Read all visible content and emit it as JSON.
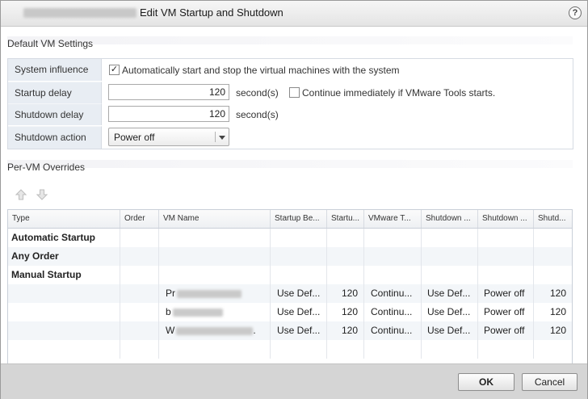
{
  "window": {
    "title": "Edit VM Startup and Shutdown",
    "help_label": "?"
  },
  "default_settings": {
    "title": "Default VM Settings",
    "system_influence": {
      "label": "System influence",
      "checked": true,
      "text": "Automatically start and stop the virtual machines with the system"
    },
    "startup_delay": {
      "label": "Startup delay",
      "value": "120",
      "unit": "second(s)",
      "continue_checked": false,
      "continue_text": "Continue immediately if VMware Tools starts."
    },
    "shutdown_delay": {
      "label": "Shutdown delay",
      "value": "120",
      "unit": "second(s)"
    },
    "shutdown_action": {
      "label": "Shutdown action",
      "value": "Power off"
    }
  },
  "overrides": {
    "title": "Per-VM Overrides",
    "toolbar": {
      "move_up_icon": "arrow-up-icon",
      "move_down_icon": "arrow-down-icon"
    },
    "columns": [
      "Type",
      "Order",
      "VM Name",
      "Startup Be...",
      "Startu...",
      "VMware T...",
      "Shutdown ...",
      "Shutdown ...",
      "Shutd..."
    ],
    "groups": [
      "Automatic Startup",
      "Any Order",
      "Manual Startup"
    ],
    "vms": [
      {
        "name_prefix": "Pr",
        "startup_behavior": "Use Def...",
        "startup_delay": "120",
        "vmware_tools": "Continu...",
        "shutdown_behavior": "Use Def...",
        "shutdown_action": "Power off",
        "shutdown_delay": "120"
      },
      {
        "name_prefix": "b",
        "startup_behavior": "Use Def...",
        "startup_delay": "120",
        "vmware_tools": "Continu...",
        "shutdown_behavior": "Use Def...",
        "shutdown_action": "Power off",
        "shutdown_delay": "120"
      },
      {
        "name_prefix": "W",
        "name_suffix": ".",
        "startup_behavior": "Use Def...",
        "startup_delay": "120",
        "vmware_tools": "Continu...",
        "shutdown_behavior": "Use Def...",
        "shutdown_action": "Power off",
        "shutdown_delay": "120"
      }
    ]
  },
  "footer": {
    "ok_label": "OK",
    "cancel_label": "Cancel"
  },
  "icons": {
    "check_mark": "✓",
    "help": "help-icon"
  }
}
